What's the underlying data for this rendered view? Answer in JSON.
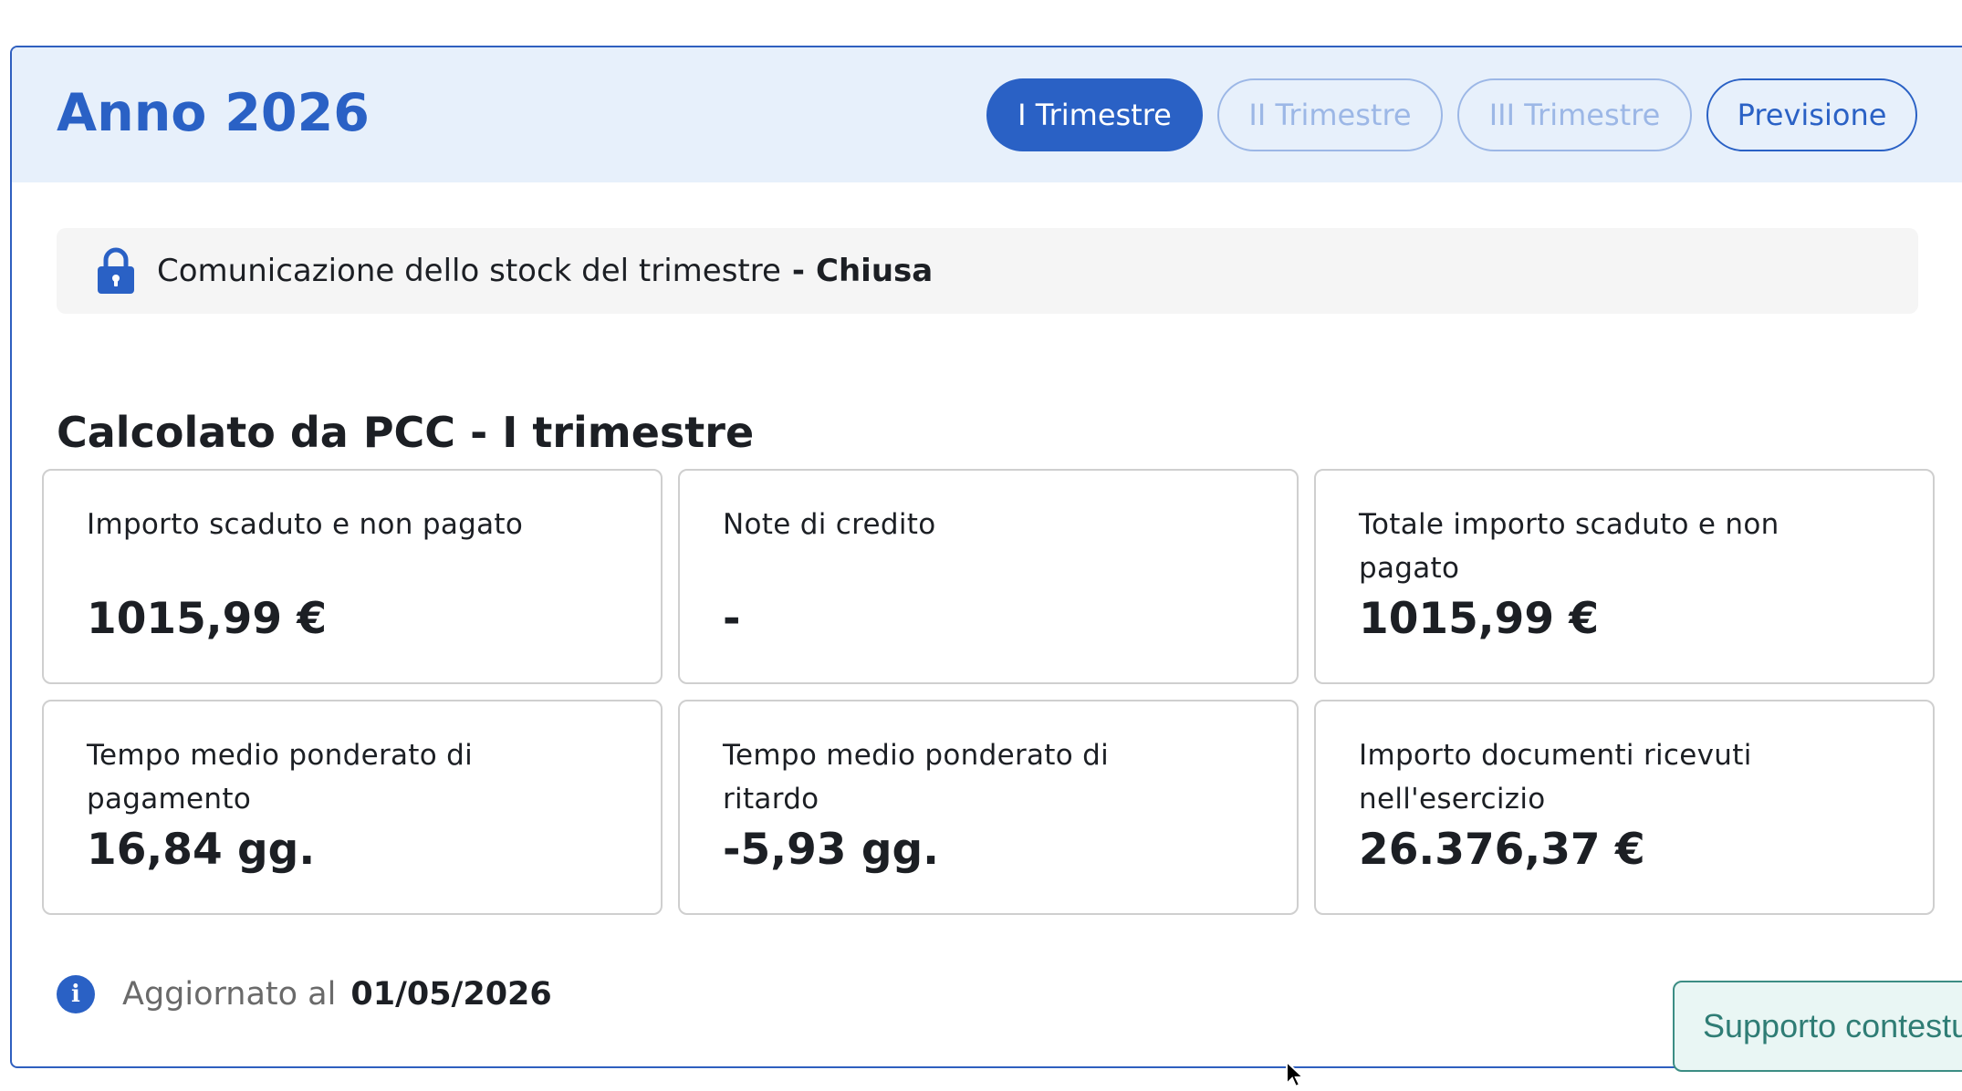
{
  "header": {
    "year_title": "Anno 2026",
    "tabs": [
      {
        "label": "I Trimestre",
        "state": "active"
      },
      {
        "label": "II Trimestre",
        "state": "disabled"
      },
      {
        "label": "III Trimestre",
        "state": "disabled"
      },
      {
        "label": "Previsione",
        "state": "enabled"
      }
    ]
  },
  "notice": {
    "icon": "lock-icon",
    "text": "Comunicazione dello stock del trimestre",
    "separator": "-",
    "status": "Chiusa"
  },
  "section": {
    "title": "Calcolato da PCC - I trimestre"
  },
  "cards": [
    {
      "label": "Importo scaduto e non pagato",
      "value": "1015,99 €"
    },
    {
      "label": "Note di credito",
      "value": "-"
    },
    {
      "label": "Totale importo scaduto e non pagato",
      "value": "1015,99 €"
    },
    {
      "label": "Tempo medio ponderato di pagamento",
      "value": "16,84 gg."
    },
    {
      "label": "Tempo medio ponderato di ritardo",
      "value": "-5,93 gg."
    },
    {
      "label": "Importo documenti ricevuti nell'esercizio",
      "value": "26.376,37 €"
    }
  ],
  "footer": {
    "icon": "info-icon",
    "updated_label": "Aggiornato al",
    "updated_date": "01/05/2026",
    "support_label": "Supporto contestuale"
  },
  "colors": {
    "primary": "#2a61c5",
    "header_bg": "#e7f0fb",
    "support": "#2f7d75"
  }
}
